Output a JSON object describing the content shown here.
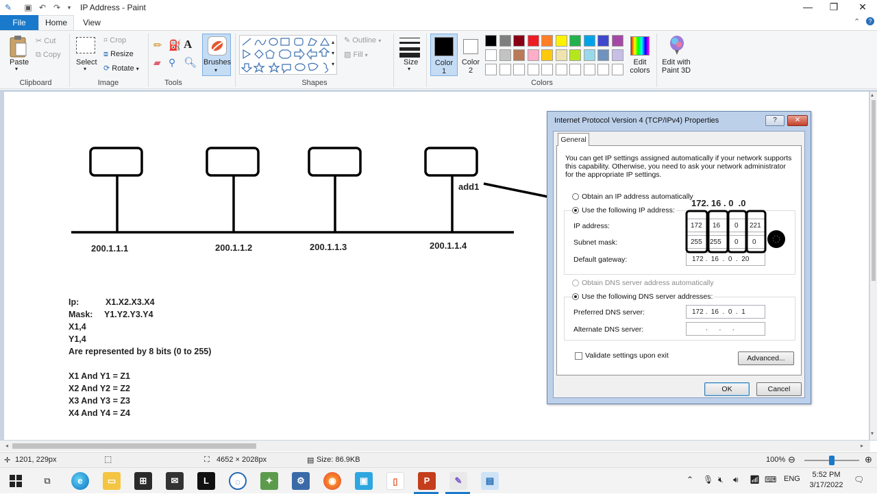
{
  "window": {
    "title": "IP Address - Paint",
    "minimize": "—",
    "maximize": "❐",
    "close": "✕"
  },
  "tabs": {
    "file": "File",
    "home": "Home",
    "view": "View"
  },
  "ribbon": {
    "clipboard": {
      "label": "Clipboard",
      "paste": "Paste",
      "cut": "Cut",
      "copy": "Copy"
    },
    "image": {
      "label": "Image",
      "select": "Select",
      "crop": "Crop",
      "resize": "Resize",
      "rotate": "Rotate"
    },
    "tools": {
      "label": "Tools"
    },
    "brushes": {
      "label": "Brushes"
    },
    "shapes": {
      "label": "Shapes",
      "outline": "Outline",
      "fill": "Fill"
    },
    "size": {
      "label": "Size"
    },
    "colors": {
      "label": "Colors",
      "color1": "Color\n1",
      "color1_line1": "Color",
      "color1_line2": "1",
      "color2_line1": "Color",
      "color2_line2": "2",
      "edit_line1": "Edit",
      "edit_line2": "colors",
      "paint3d_line1": "Edit with",
      "paint3d_line2": "Paint 3D",
      "palette_row1": [
        "#000000",
        "#7f7f7f",
        "#880015",
        "#ed1c24",
        "#ff7f27",
        "#fff200",
        "#22b14c",
        "#00a2e8",
        "#3f48cc",
        "#a349a4"
      ],
      "palette_row2": [
        "#ffffff",
        "#c3c3c3",
        "#b97a57",
        "#ffaec9",
        "#ffc90e",
        "#efe4b0",
        "#b5e61d",
        "#99d9ea",
        "#7092be",
        "#c8bfe7"
      ]
    }
  },
  "drawing": {
    "hosts": [
      "200.1.1.1",
      "200.1.1.2",
      "200.1.1.3",
      "200.1.1.4"
    ],
    "add_label": "add1",
    "dialog_annotation": "172. 16 . 0  .0",
    "notes": [
      {
        "left": "Ip:",
        "right": "X1.X2.X3.X4"
      },
      {
        "left": "Mask:",
        "right": "Y1.Y2.Y3.Y4"
      }
    ],
    "lines": [
      "X1,4",
      "Y1,4",
      "Are represented by 8 bits (0 to 255)"
    ],
    "and_lines": [
      "X1 And Y1  = Z1",
      "X2 And Y2  = Z2",
      "X3 And Y3  = Z3",
      "X4 And Y4  = Z4"
    ]
  },
  "dialog": {
    "title": "Internet Protocol Version 4 (TCP/IPv4) Properties",
    "help": "?",
    "close": "✕",
    "tab": "General",
    "intro": [
      "You can get IP settings assigned automatically if your network supports",
      "this capability. Otherwise, you need to ask your network administrator",
      "for the appropriate IP settings."
    ],
    "obtain_ip": "Obtain an IP address automatically",
    "use_ip": "Use the following IP address:",
    "ip_label": "IP address:",
    "ip_value": [
      "172",
      "16",
      "0",
      "221"
    ],
    "mask_label": "Subnet mask:",
    "mask_value": [
      "255",
      "255",
      "0",
      "0"
    ],
    "gateway_label": "Default gateway:",
    "gateway_value": "172 .  16  .  0  .  20",
    "obtain_dns": "Obtain DNS server address automatically",
    "use_dns": "Use the following DNS server addresses:",
    "preferred_label": "Preferred DNS server:",
    "preferred_value": "172 .  16  .  0  .  1",
    "alternate_label": "Alternate DNS server:",
    "alternate_value": ".      .      .",
    "validate": "Validate settings upon exit",
    "advanced": "Advanced...",
    "ok": "OK",
    "cancel": "Cancel"
  },
  "status": {
    "cursor": "1201, 229px",
    "dimensions": "4652 × 2028px",
    "size": "Size: 86.9KB",
    "zoom": "100%"
  },
  "taskbar": {
    "lang": "ENG",
    "time": "5:52 PM",
    "date": "3/17/2022"
  }
}
